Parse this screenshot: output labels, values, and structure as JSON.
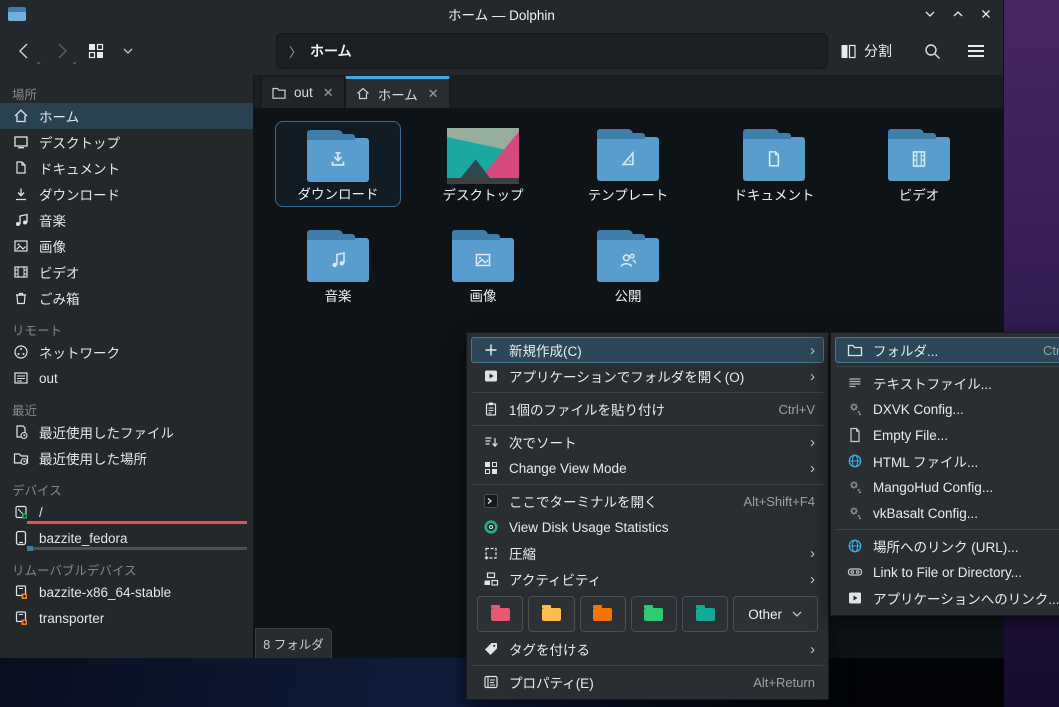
{
  "window": {
    "title": "ホーム — Dolphin"
  },
  "toolbar": {
    "breadcrumb_root_label": "ホーム",
    "split_label": "分割"
  },
  "tabs": {
    "tab1": "out",
    "tab2": "ホーム"
  },
  "sidebar": {
    "sections": [
      {
        "header": "場所",
        "items": [
          {
            "label": "ホーム"
          },
          {
            "label": "デスクトップ"
          },
          {
            "label": "ドキュメント"
          },
          {
            "label": "ダウンロード"
          },
          {
            "label": "音楽"
          },
          {
            "label": "画像"
          },
          {
            "label": "ビデオ"
          },
          {
            "label": "ごみ箱"
          }
        ]
      },
      {
        "header": "リモート",
        "items": [
          {
            "label": "ネットワーク"
          },
          {
            "label": "out"
          }
        ]
      },
      {
        "header": "最近",
        "items": [
          {
            "label": "最近使用したファイル"
          },
          {
            "label": "最近使用した場所"
          }
        ]
      },
      {
        "header": "デバイス",
        "items": [
          {
            "label": "/"
          },
          {
            "label": "bazzite_fedora"
          }
        ]
      },
      {
        "header": "リムーバブルデバイス",
        "items": [
          {
            "label": "bazzite-x86_64-stable"
          },
          {
            "label": "transporter"
          }
        ]
      }
    ]
  },
  "folders": [
    {
      "label": "ダウンロード"
    },
    {
      "label": "デスクトップ"
    },
    {
      "label": "テンプレート"
    },
    {
      "label": "ドキュメント"
    },
    {
      "label": "ビデオ"
    },
    {
      "label": "音楽"
    },
    {
      "label": "画像"
    },
    {
      "label": "公開"
    }
  ],
  "statusbar": {
    "text": "8 フォルダ"
  },
  "context_menu": {
    "items": [
      {
        "label": "新規作成(C)"
      },
      {
        "label": "アプリケーションでフォルダを開く(O)"
      },
      {
        "label": "1個のファイルを貼り付け",
        "shortcut": "Ctrl+V"
      },
      {
        "label": "次でソート"
      },
      {
        "label": "Change View Mode"
      },
      {
        "label": "ここでターミナルを開く",
        "shortcut": "Alt+Shift+F4"
      },
      {
        "label": "View Disk Usage Statistics"
      },
      {
        "label": "圧縮"
      },
      {
        "label": "アクティビティ"
      },
      {
        "label": "タグを付ける"
      },
      {
        "label": "プロパティ(E)",
        "shortcut": "Alt+Return"
      }
    ],
    "color_row": {
      "other_label": "Other",
      "colors": [
        "#e8596f",
        "#fdbc4b",
        "#f67400",
        "#2ecc71",
        "#16a896"
      ]
    }
  },
  "submenu": {
    "items": [
      {
        "label": "フォルダ...",
        "shortcut": "Ctrl"
      },
      {
        "label": "テキストファイル..."
      },
      {
        "label": "DXVK Config..."
      },
      {
        "label": "Empty File..."
      },
      {
        "label": "HTML ファイル..."
      },
      {
        "label": "MangoHud Config..."
      },
      {
        "label": "vkBasalt Config..."
      },
      {
        "label": "場所へのリンク (URL)..."
      },
      {
        "label": "Link to File or Directory..."
      },
      {
        "label": "アプリケーションへのリンク..."
      }
    ]
  }
}
